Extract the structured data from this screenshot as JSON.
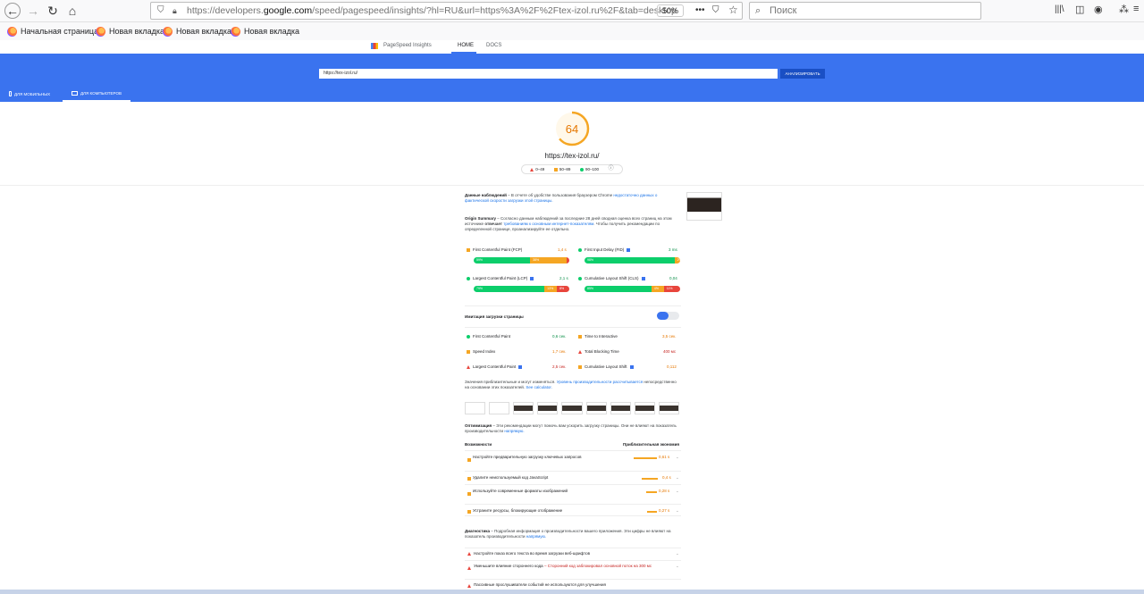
{
  "browser": {
    "url_prefix": "https://developers.",
    "url_domain": "google.com",
    "url_suffix": "/speed/pagespeed/insights/?hl=RU&url=https%3A%2F%2Ftex-izol.ru%2F&tab=desktop",
    "zoom": "50%",
    "search_placeholder": "Поиск"
  },
  "bookmarks": [
    "Начальная страница",
    "Новая вкладка",
    "Новая вкладка",
    "Новая вкладка"
  ],
  "psi": {
    "brand": "PageSpeed Insights",
    "nav": [
      "HOME",
      "DOCS"
    ],
    "input_value": "https://tex-izol.ru/",
    "analyze_label": "АНАЛИЗИРОВАТЬ",
    "device_tabs": [
      "ДЛЯ МОБИЛЬНЫХ",
      "ДЛЯ КОМПЬЮТЕРОВ"
    ]
  },
  "score": {
    "value": "64",
    "fraction": 0.64,
    "site": "https://tex-izol.ru/",
    "legend": [
      "0–49",
      "50–89",
      "90–100"
    ],
    "colors": {
      "fail": "#e8453c",
      "average": "#f5a623",
      "pass": "#0cce6b"
    }
  },
  "field_data": {
    "title": "Данные наблюдений",
    "desc": "– В отчете об удобстве пользования браузером Chrome",
    "link": "недостаточно данных о фактической скорости загрузки этой страницы.",
    "origin_title": "Origin Summary",
    "origin_desc": "– Согласно данным наблюдений за последние 28 дней сводная оценка всех страниц на этом источнике",
    "origin_bold": "отвечает",
    "origin_link": "требованиям к основным интернет-показателям",
    "origin_tail": ". Чтобы получить рекомендации по определенной странице, проанализируйте ее отдельно.",
    "metrics": [
      {
        "name": "First Contentful Paint (FCP)",
        "value": "1,4 s",
        "dist": [
          "59%",
          "38%",
          "3%"
        ]
      },
      {
        "name": "First Input Delay (FID)",
        "value": "3 ms",
        "dist": [
          "98%",
          "",
          "2%"
        ]
      },
      {
        "name": "Largest Contentful Paint (LCP)",
        "value": "2,1 s",
        "dist": [
          "79%",
          "13%",
          "8%"
        ]
      },
      {
        "name": "Cumulative Layout Shift (CLS)",
        "value": "0,04",
        "dist": [
          "85%",
          "4%",
          "11%"
        ]
      }
    ]
  },
  "lab": {
    "title": "Имитация загрузки страницы",
    "metrics": [
      {
        "name": "First Contentful Paint",
        "value": "0,6 сек."
      },
      {
        "name": "Time to Interactive",
        "value": "3,5 сек."
      },
      {
        "name": "Speed Index",
        "value": "1,7 сек."
      },
      {
        "name": "Total Blocking Time",
        "value": "400 мс"
      },
      {
        "name": "Largest Contentful Paint",
        "value": "2,5 сек."
      },
      {
        "name": "Cumulative Layout Shift",
        "value": "0,112"
      }
    ],
    "note": "Значения приблизительные и могут изменяться.",
    "note_link": "Уровень производительности рассчитывается",
    "note_tail": "непосредственно на основании этих показателей.",
    "calc_link": "See calculator."
  },
  "opportunities": {
    "title": "Оптимизация",
    "desc": "– Эти рекомендации могут помочь вам ускорить загрузку страницы. Они не влияют на показатель производительности",
    "desc_link": "напрямую.",
    "col_left": "Возможности",
    "col_right": "Приблизительная экономия",
    "items": [
      {
        "label": "Настройте предварительную загрузку ключевых запросов",
        "value": "0,61 s"
      },
      {
        "label": "Удалите неиспользуемый код JavaScript",
        "value": "0,4 s"
      },
      {
        "label": "Используйте современные форматы изображений",
        "value": "0,28 s"
      },
      {
        "label": "Устраните ресурсы, блокирующие отображение",
        "value": "0,27 s"
      }
    ]
  },
  "diagnostics": {
    "title": "Диагностика",
    "desc": "– Подробная информация о производительности вашего приложения. Эти цифры не влияют на показатель производительности",
    "desc_link": "напрямую.",
    "items": [
      {
        "label": "Настройте показ всего текста во время загрузки веб-шрифтов",
        "extra": ""
      },
      {
        "label": "Уменьшите влияние стороннего кода",
        "extra": "– Сторонний код заблокировал основной поток на 300 мс"
      },
      {
        "label": "Пассивные прослушиватели событий не используются для улучшения",
        "extra": ""
      }
    ]
  }
}
